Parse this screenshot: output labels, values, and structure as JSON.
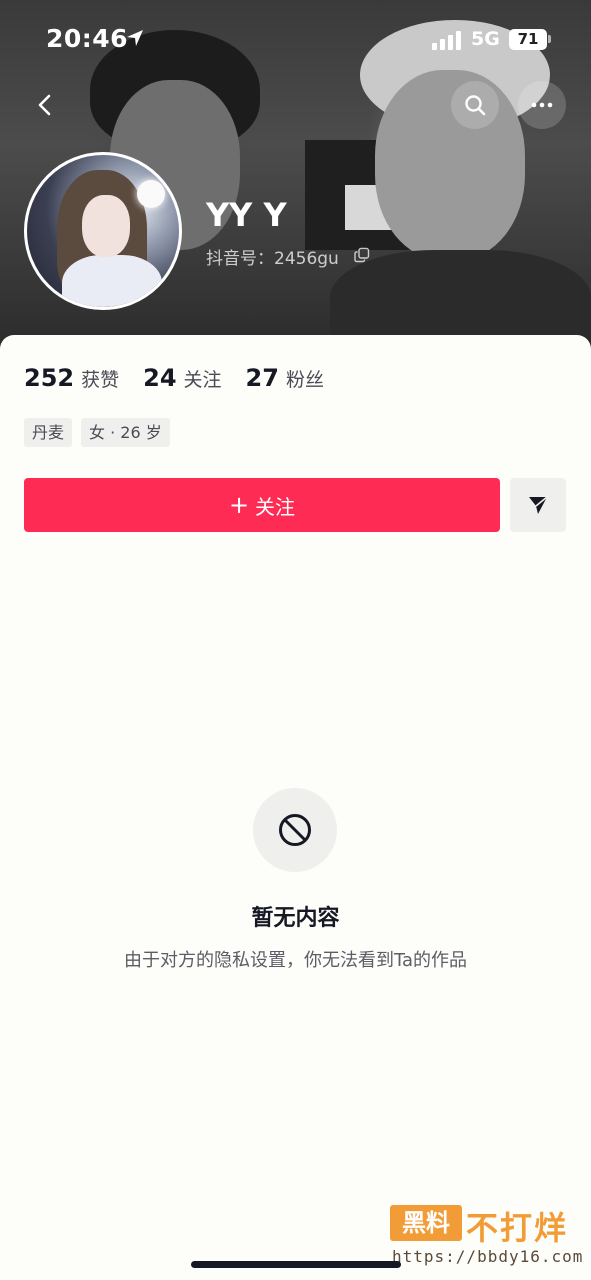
{
  "status_bar": {
    "time": "20:46",
    "network": "5G",
    "battery": "71",
    "icons": [
      "location-arrow-icon",
      "signal-icon"
    ]
  },
  "nav": {
    "icons": [
      "back-icon",
      "search-icon",
      "more-icon"
    ]
  },
  "profile": {
    "name": "YY Y",
    "douyin_id": "抖音号：2456gu",
    "copy_icon": "copy-icon"
  },
  "stats": [
    {
      "value": "252",
      "label": "获赞"
    },
    {
      "value": "24",
      "label": "关注"
    },
    {
      "value": "27",
      "label": "粉丝"
    }
  ],
  "tags": [
    "丹麦",
    "女 · 26 岁"
  ],
  "actions": {
    "follow_plus": "+",
    "follow_label": "关注",
    "message_icon": "send-icon"
  },
  "empty_state": {
    "icon": "blocked-icon",
    "title": "暂无内容",
    "description": "由于对方的隐私设置，你无法看到Ta的作品"
  },
  "watermark": {
    "badge": "黑料",
    "text": "不打烊",
    "url": "https://bbdy16.com"
  },
  "colors": {
    "accent": "#fe2c55",
    "text_primary": "#161823",
    "watermark": "#f29c38"
  }
}
